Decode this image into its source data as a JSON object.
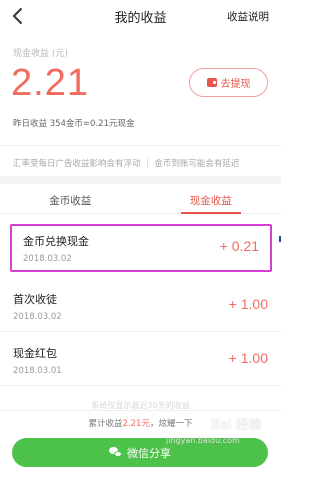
{
  "header": {
    "title": "我的收益",
    "right_label": "收益说明"
  },
  "cash": {
    "label": "现金收益 (元)",
    "amount": "2.21",
    "withdraw_label": "去提现",
    "yesterday": "昨日收益 354金币=0.21元现金"
  },
  "notice": "汇率受每日广告收益影响会有浮动 ｜ 金币到账可能会有延迟",
  "tabs": [
    {
      "label": "金币收益"
    },
    {
      "label": "现金收益"
    }
  ],
  "records": [
    {
      "name": "金币兑换现金",
      "date": "2018.03.02",
      "amount": "+ 0.21"
    },
    {
      "name": "首次收徒",
      "date": "2018.03.02",
      "amount": "+ 1.00"
    },
    {
      "name": "现金红包",
      "date": "2018.03.01",
      "amount": "+ 1.00"
    }
  ],
  "faded_text": "系统仅显示最近30天的收益",
  "bottom": {
    "total_prefix": "累计收益",
    "total_amount": "2.21元",
    "total_suffix": "，炫耀一下",
    "share_label": "微信分享"
  },
  "watermark": {
    "brand": "Bai 经验",
    "url": "jingyan.baidu.com"
  },
  "colors": {
    "accent": "#f36a5f",
    "share_green": "#4cc24a",
    "highlight_border": "#d53fd1"
  }
}
